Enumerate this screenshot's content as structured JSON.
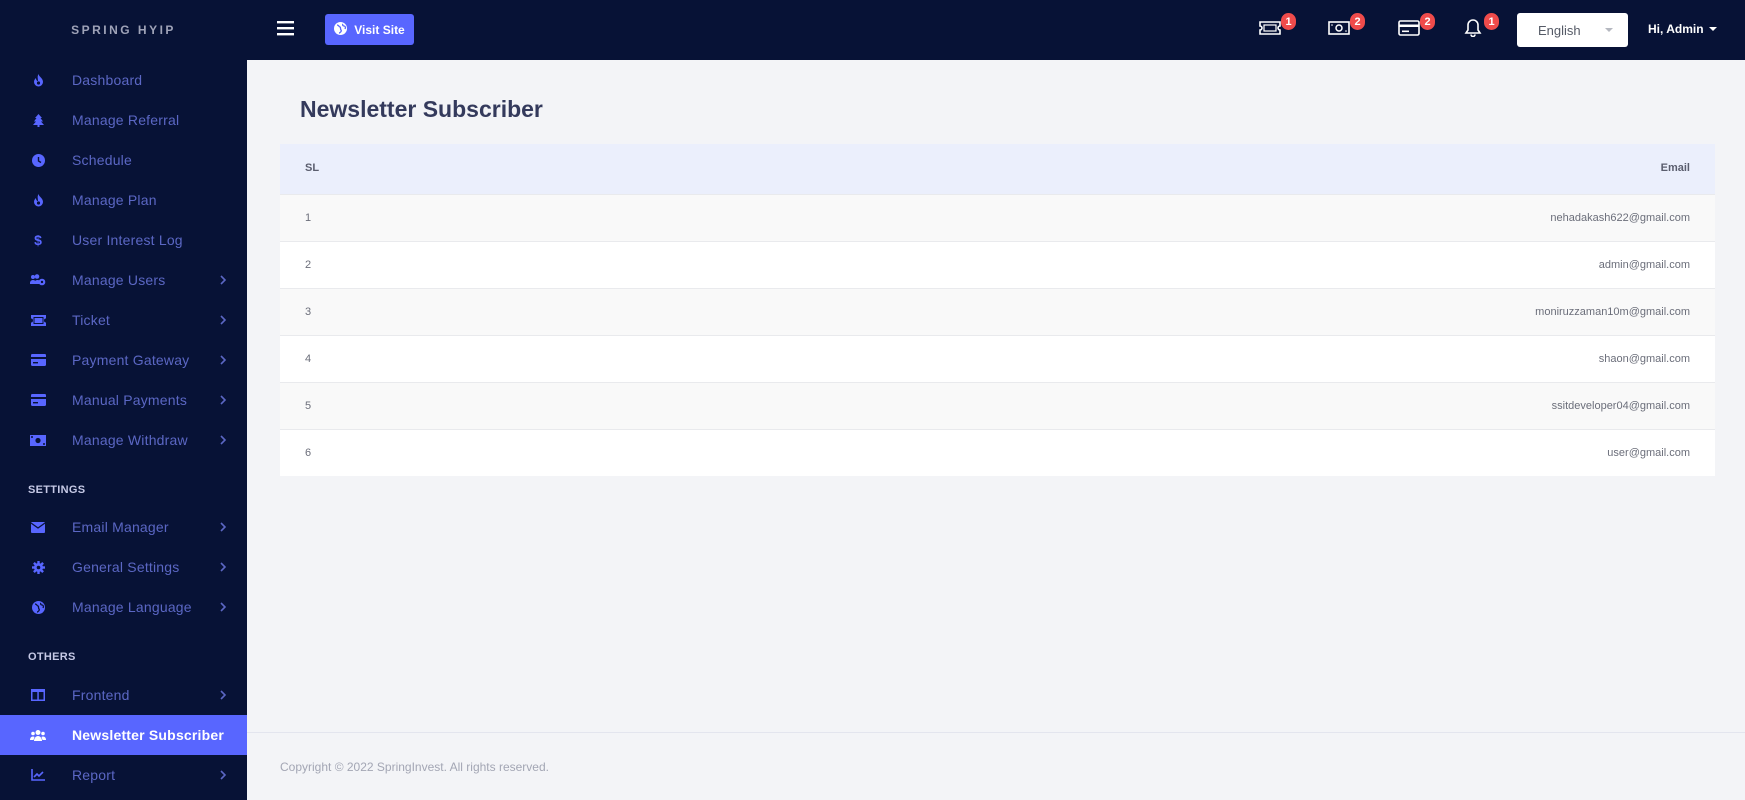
{
  "brand": "SPRING HYIP",
  "sidebar": {
    "items": [
      {
        "label": "Dashboard",
        "icon": "fire-icon",
        "has_children": false
      },
      {
        "label": "Manage Referral",
        "icon": "tree-icon",
        "has_children": false
      },
      {
        "label": "Schedule",
        "icon": "clock-icon",
        "has_children": false
      },
      {
        "label": "Manage Plan",
        "icon": "fire-icon",
        "has_children": false
      },
      {
        "label": "User Interest Log",
        "icon": "dollar-icon",
        "has_children": false
      },
      {
        "label": "Manage Users",
        "icon": "users-cog-icon",
        "has_children": true
      },
      {
        "label": "Ticket",
        "icon": "ticket-icon",
        "has_children": true
      },
      {
        "label": "Payment Gateway",
        "icon": "credit-card-icon",
        "has_children": true
      },
      {
        "label": "Manual Payments",
        "icon": "credit-card-icon",
        "has_children": true
      },
      {
        "label": "Manage Withdraw",
        "icon": "money-bill-icon",
        "has_children": true
      }
    ],
    "settings_heading": "SETTINGS",
    "settings_items": [
      {
        "label": "Email Manager",
        "icon": "envelope-icon",
        "has_children": true
      },
      {
        "label": "General Settings",
        "icon": "gear-icon",
        "has_children": true
      },
      {
        "label": "Manage Language",
        "icon": "globe-icon",
        "has_children": true
      }
    ],
    "others_heading": "OTHERS",
    "others_items": [
      {
        "label": "Frontend",
        "icon": "columns-icon",
        "has_children": true
      },
      {
        "label": "Newsletter Subscriber",
        "icon": "users-icon",
        "has_children": false,
        "active": true
      },
      {
        "label": "Report",
        "icon": "chart-line-icon",
        "has_children": true
      }
    ]
  },
  "topbar": {
    "visit_site_label": "Visit Site",
    "notifications": [
      {
        "icon": "ticket-icon",
        "count": "1"
      },
      {
        "icon": "money-bill-icon",
        "count": "2"
      },
      {
        "icon": "credit-card-icon",
        "count": "2"
      },
      {
        "icon": "bell-icon",
        "count": "1"
      }
    ],
    "language": "English",
    "user_greeting": "Hi, Admin"
  },
  "page": {
    "title": "Newsletter Subscriber",
    "table": {
      "columns": [
        "SL",
        "Email"
      ],
      "rows": [
        {
          "sl": "1",
          "email": "nehadakash622@gmail.com"
        },
        {
          "sl": "2",
          "email": "admin@gmail.com"
        },
        {
          "sl": "3",
          "email": "moniruzzaman10m@gmail.com"
        },
        {
          "sl": "4",
          "email": "shaon@gmail.com"
        },
        {
          "sl": "5",
          "email": "ssitdeveloper04@gmail.com"
        },
        {
          "sl": "6",
          "email": "user@gmail.com"
        }
      ]
    }
  },
  "footer": {
    "copyright": "Copyright © 2022 SpringInvest. All rights reserved."
  },
  "colors": {
    "sidebar_bg": "#071236",
    "accent": "#5866ff",
    "badge": "#ef4b4b"
  }
}
